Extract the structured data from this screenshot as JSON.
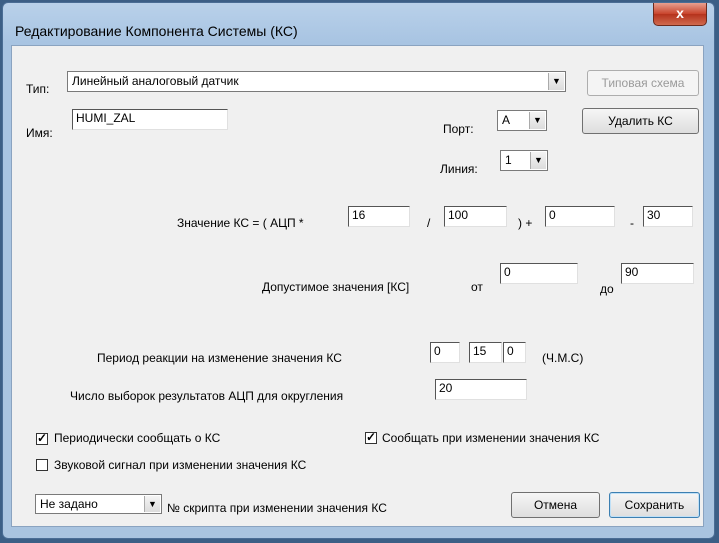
{
  "window": {
    "title": "Редактирование Компонента Системы (КС)",
    "close": "x"
  },
  "type": {
    "label": "Тип:",
    "value": "Линейный аналоговый датчик"
  },
  "typical_scheme_button": "Типовая схема",
  "name": {
    "label": "Имя:",
    "value": "HUMI_ZAL"
  },
  "port": {
    "label": "Порт:",
    "value": "A"
  },
  "delete_button": "Удалить КС",
  "line": {
    "label": "Линия:",
    "value": "1"
  },
  "formula": {
    "prefix": "Значение КС = ( АЦП *",
    "mult": "16",
    "div_sign": "/",
    "div": "100",
    "plus_sign": ") +",
    "add": "0",
    "minus_sign": "-",
    "sub": "30"
  },
  "range": {
    "label": "Допустимое значения [КС]",
    "from_label": "от",
    "from": "0",
    "to_label": "до",
    "to": "90"
  },
  "period": {
    "label": "Период реакции на изменение значения КС",
    "h": "0",
    "m": "15",
    "s": "0",
    "unit": "(Ч.М.С)"
  },
  "samples": {
    "label": "Число выборок результатов АЦП для округления",
    "value": "20"
  },
  "checkboxes": {
    "periodic": {
      "label": "Периодически сообщать о КС",
      "checked": true
    },
    "on_change": {
      "label": "Сообщать при изменении значения КС",
      "checked": true
    },
    "sound": {
      "label": "Звуковой сигнал при изменении значения КС",
      "checked": false
    }
  },
  "script": {
    "value": "Не задано",
    "label": "№ скрипта при изменении значения КС"
  },
  "cancel_button": "Отмена",
  "save_button": "Сохранить",
  "check_mark": "✓",
  "arrow_glyph": "▼"
}
